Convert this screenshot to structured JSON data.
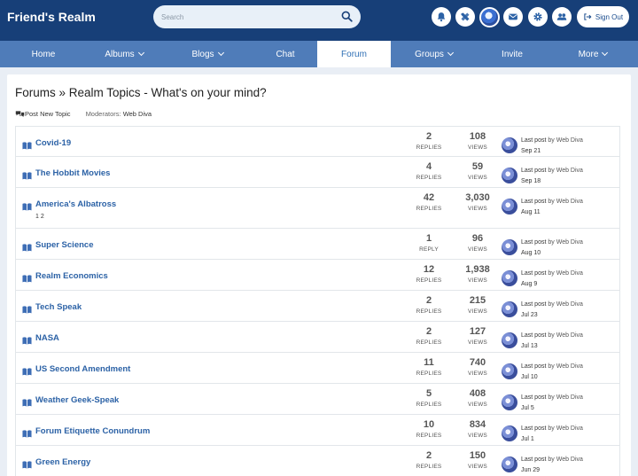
{
  "header": {
    "site_name": "Friend's Realm",
    "search_placeholder": "Search",
    "sign_out_label": "Sign Out"
  },
  "nav": [
    {
      "label": "Home",
      "dropdown": false,
      "active": false
    },
    {
      "label": "Albums",
      "dropdown": true,
      "active": false
    },
    {
      "label": "Blogs",
      "dropdown": true,
      "active": false
    },
    {
      "label": "Chat",
      "dropdown": false,
      "active": false
    },
    {
      "label": "Forum",
      "dropdown": false,
      "active": true
    },
    {
      "label": "Groups",
      "dropdown": true,
      "active": false
    },
    {
      "label": "Invite",
      "dropdown": false,
      "active": false
    },
    {
      "label": "More",
      "dropdown": true,
      "active": false
    }
  ],
  "page": {
    "title": "Forums » Realm Topics - What's on your mind?",
    "post_new_topic": "Post New Topic",
    "moderators_label": "Moderators:",
    "moderator_name": "Web Diva"
  },
  "topics": [
    {
      "title": "Covid-19",
      "pages": "",
      "replies": "2",
      "replies_label": "REPLIES",
      "views": "108",
      "views_label": "VIEWS",
      "last_post_prefix": "Last post",
      "last_post_by": "by Web Diva",
      "last_post_date": "Sep 21"
    },
    {
      "title": "The Hobbit Movies",
      "pages": "",
      "replies": "4",
      "replies_label": "REPLIES",
      "views": "59",
      "views_label": "VIEWS",
      "last_post_prefix": "Last post",
      "last_post_by": "by Web Diva",
      "last_post_date": "Sep 18"
    },
    {
      "title": "America's Albatross",
      "pages": "1 2",
      "replies": "42",
      "replies_label": "REPLIES",
      "views": "3,030",
      "views_label": "VIEWS",
      "last_post_prefix": "Last post",
      "last_post_by": "by Web Diva",
      "last_post_date": "Aug 11"
    },
    {
      "title": "Super Science",
      "pages": "",
      "replies": "1",
      "replies_label": "REPLY",
      "views": "96",
      "views_label": "VIEWS",
      "last_post_prefix": "Last post",
      "last_post_by": "by Web Diva",
      "last_post_date": "Aug 10"
    },
    {
      "title": "Realm Economics",
      "pages": "",
      "replies": "12",
      "replies_label": "REPLIES",
      "views": "1,938",
      "views_label": "VIEWS",
      "last_post_prefix": "Last post",
      "last_post_by": "by Web Diva",
      "last_post_date": "Aug 9"
    },
    {
      "title": "Tech Speak",
      "pages": "",
      "replies": "2",
      "replies_label": "REPLIES",
      "views": "215",
      "views_label": "VIEWS",
      "last_post_prefix": "Last post",
      "last_post_by": "by Web Diva",
      "last_post_date": "Jul 23"
    },
    {
      "title": "NASA",
      "pages": "",
      "replies": "2",
      "replies_label": "REPLIES",
      "views": "127",
      "views_label": "VIEWS",
      "last_post_prefix": "Last post",
      "last_post_by": "by Web Diva",
      "last_post_date": "Jul 13"
    },
    {
      "title": "US Second Amendment",
      "pages": "",
      "replies": "11",
      "replies_label": "REPLIES",
      "views": "740",
      "views_label": "VIEWS",
      "last_post_prefix": "Last post",
      "last_post_by": "by Web Diva",
      "last_post_date": "Jul 10"
    },
    {
      "title": "Weather Geek-Speak",
      "pages": "",
      "replies": "5",
      "replies_label": "REPLIES",
      "views": "408",
      "views_label": "VIEWS",
      "last_post_prefix": "Last post",
      "last_post_by": "by Web Diva",
      "last_post_date": "Jul 5"
    },
    {
      "title": "Forum Etiquette Conundrum",
      "pages": "",
      "replies": "10",
      "replies_label": "REPLIES",
      "views": "834",
      "views_label": "VIEWS",
      "last_post_prefix": "Last post",
      "last_post_by": "by Web Diva",
      "last_post_date": "Jul 1"
    },
    {
      "title": "Green Energy",
      "pages": "",
      "replies": "2",
      "replies_label": "REPLIES",
      "views": "150",
      "views_label": "VIEWS",
      "last_post_prefix": "Last post",
      "last_post_by": "by Web Diva",
      "last_post_date": "Jun 29"
    }
  ],
  "icons": [
    "search-icon",
    "bell-icon",
    "tools-icon",
    "avatar",
    "mail-icon",
    "gear-icon",
    "users-icon",
    "sign-out-icon",
    "chevron-down-icon",
    "chat-bubbles-icon",
    "book-icon"
  ],
  "colors": {
    "header_bg": "#173f78",
    "nav_bg": "#4f7cb9",
    "link": "#2c62a6",
    "page_bg": "#e9eef5"
  }
}
